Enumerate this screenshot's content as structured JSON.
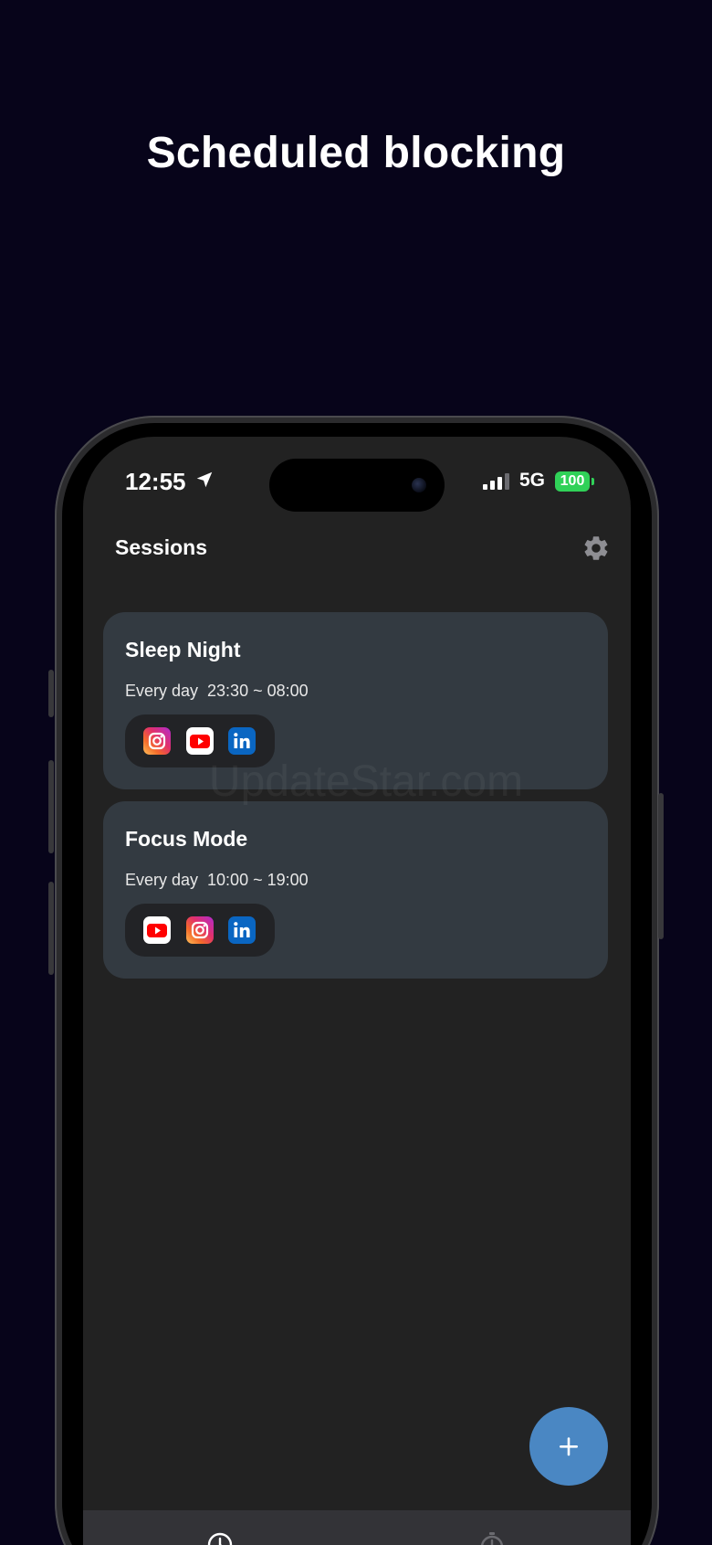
{
  "promo": {
    "headline": "Scheduled blocking"
  },
  "status_bar": {
    "time": "12:55",
    "network": "5G",
    "battery": "100",
    "icons": [
      "location-arrow-icon",
      "cellular-signal-icon"
    ]
  },
  "header": {
    "title": "Sessions",
    "settings_icon": "gear-icon"
  },
  "sessions": [
    {
      "title": "Sleep Night",
      "schedule": "Every day  23:30 ~ 08:00",
      "apps": [
        "instagram-icon",
        "youtube-icon",
        "linkedin-icon"
      ]
    },
    {
      "title": "Focus Mode",
      "schedule": "Every day  10:00 ~ 19:00",
      "apps": [
        "youtube-icon",
        "instagram-icon",
        "linkedin-icon"
      ]
    }
  ],
  "fab": {
    "icon": "plus-icon"
  },
  "tab_bar": {
    "icons": [
      "clock-icon",
      "stopwatch-icon"
    ]
  },
  "watermark": "UpdateStar.com",
  "colors": {
    "page_background": "#07041a",
    "screen_background": "#222222",
    "card_background": "#333a41",
    "fab": "#4a87c3",
    "battery": "#30d158",
    "linkedin": "#0a66c2",
    "youtube_red": "#ff0000"
  }
}
